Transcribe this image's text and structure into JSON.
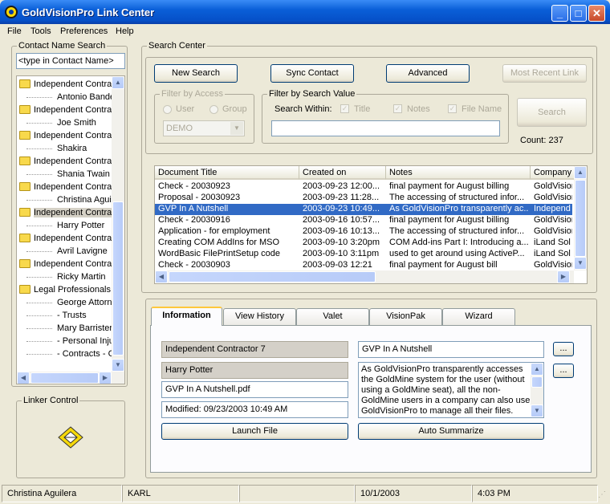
{
  "window": {
    "title": "GoldVisionPro Link Center"
  },
  "menu": [
    "File",
    "Tools",
    "Preferences",
    "Help"
  ],
  "contact_search": {
    "group_label": "Contact Name Search",
    "input_value": "<type in Contact Name>"
  },
  "tree": [
    {
      "type": "folder",
      "label": "Independent Contra"
    },
    {
      "type": "item",
      "label": "Antonio Bande"
    },
    {
      "type": "folder",
      "label": "Independent Contra"
    },
    {
      "type": "item",
      "label": "Joe Smith"
    },
    {
      "type": "folder",
      "label": "Independent Contra"
    },
    {
      "type": "item",
      "label": "Shakira"
    },
    {
      "type": "folder",
      "label": "Independent Contra"
    },
    {
      "type": "item",
      "label": "Shania Twain"
    },
    {
      "type": "folder",
      "label": "Independent Contra"
    },
    {
      "type": "item",
      "label": "Christina Aguil"
    },
    {
      "type": "folder",
      "label": "Independent Contra",
      "selected": true
    },
    {
      "type": "item",
      "label": "Harry Potter"
    },
    {
      "type": "folder",
      "label": "Independent Contra"
    },
    {
      "type": "item",
      "label": "Avril Lavigne"
    },
    {
      "type": "folder",
      "label": "Independent Contra"
    },
    {
      "type": "item",
      "label": "Ricky Martin"
    },
    {
      "type": "folder",
      "label": "Legal Professionals,"
    },
    {
      "type": "item",
      "label": "George Attorn"
    },
    {
      "type": "item",
      "label": "- Trusts"
    },
    {
      "type": "item",
      "label": "Mary Barrister"
    },
    {
      "type": "item",
      "label": "- Personal Inju"
    },
    {
      "type": "item",
      "label": "- Contracts - C"
    }
  ],
  "linker": {
    "label": "Linker Control"
  },
  "search_center": {
    "label": "Search Center",
    "new_search": "New Search",
    "sync_contact": "Sync Contact",
    "advanced": "Advanced",
    "most_recent_link": "Most Recent Link",
    "search": "Search",
    "count": "Count: 237",
    "filter_access": {
      "label": "Filter by Access",
      "user": "User",
      "group": "Group",
      "select_value": "DEMO"
    },
    "filter_value": {
      "label": "Filter by Search Value",
      "search_within": "Search Within:",
      "title": "Title",
      "notes": "Notes",
      "file_name": "File Name",
      "input_value": ""
    }
  },
  "results": {
    "columns": [
      "Document Title",
      "Created on",
      "Notes",
      "Company"
    ],
    "rows": [
      [
        "Check - 20030923",
        "2003-09-23 12:00...",
        "final payment for August billing",
        "GoldVision"
      ],
      [
        "Proposal - 20030923",
        "2003-09-23 11:28...",
        "The accessing of structured infor...",
        "GoldVision"
      ],
      [
        "GVP In A Nutshell",
        "2003-09-23 10:49...",
        "As GoldVisionPro transparently ac...",
        "Independ"
      ],
      [
        "Check - 20030916",
        "2003-09-16 10:57...",
        "final payment for August billing",
        "GoldVision"
      ],
      [
        "Application - for employment",
        "2003-09-16 10:13...",
        "The accessing of structured infor...",
        "GoldVision"
      ],
      [
        "Creating COM AddIns for MSO",
        "2003-09-10  3:20pm",
        "COM Add-ins Part I: Introducing a...",
        "iLand Sol"
      ],
      [
        "WordBasic FilePrintSetup code",
        "2003-09-10  3:11pm",
        "used to get around using ActiveP...",
        "iLand Sol"
      ],
      [
        "Check - 20030903",
        "2003-09-03 12:21",
        "final payment for August bill",
        "GoldVision"
      ]
    ],
    "selected_index": 2
  },
  "tabs": [
    "Information",
    "View History",
    "Valet",
    "VisionPak",
    "Wizard"
  ],
  "info": {
    "company": "Independent Contractor 7",
    "contact": "Harry Potter",
    "file": "GVP In A Nutshell.pdf",
    "modified": "Modified: 09/23/2003 10:49 AM",
    "title": "GVP In A Nutshell",
    "notes": "As GoldVisionPro transparently accesses the GoldMine system for the user (without using a GoldMine seat), all the non-GoldMine users in a company can also use GoldVisionPro to manage all their files.",
    "ellipsis": "...",
    "launch_file": "Launch File",
    "auto_summarize": "Auto Summarize"
  },
  "statusbar": [
    "Christina Aguilera",
    "KARL",
    "",
    "10/1/2003",
    "4:03 PM"
  ]
}
